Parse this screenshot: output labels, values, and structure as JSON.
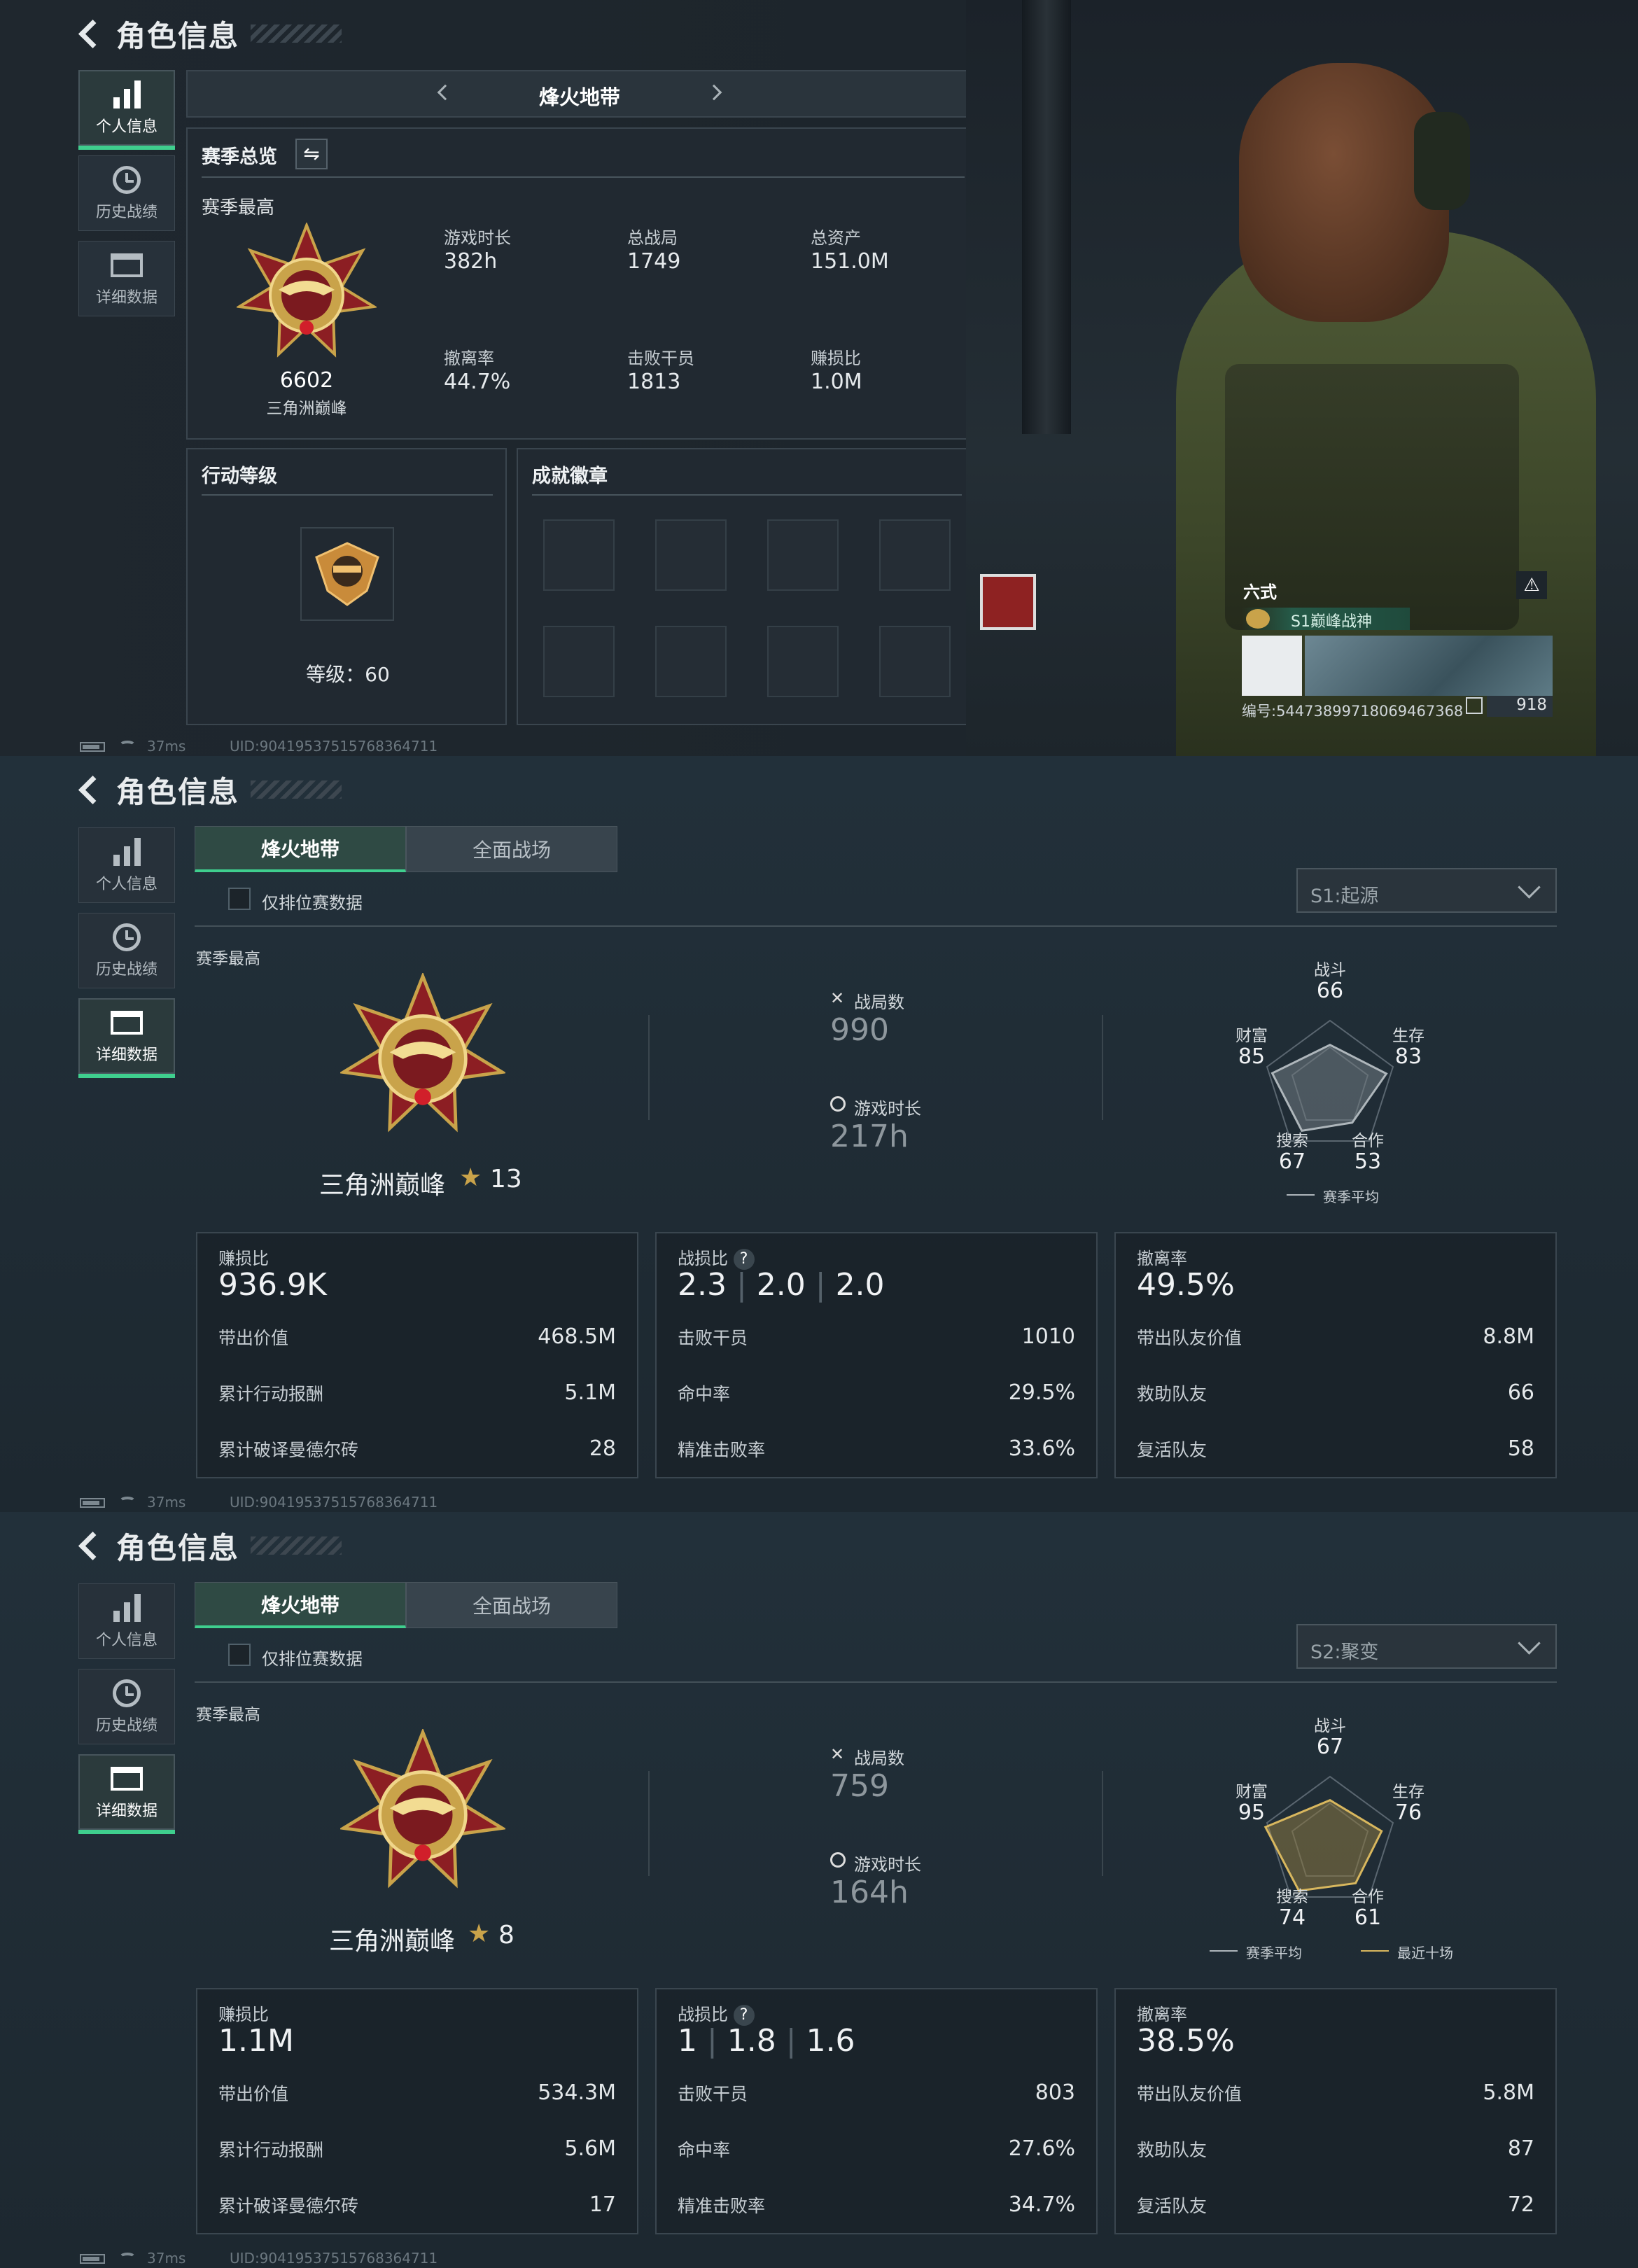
{
  "colors": {
    "accent": "#3fcf8e",
    "gold": "#c9a34a"
  },
  "shared": {
    "title": "角色信息",
    "sidebar": [
      "个人信息",
      "历史战绩",
      "详细数据"
    ],
    "ping": "37ms",
    "uid": "UID:9041953751576836471​1"
  },
  "panel1": {
    "mode_title": "烽火地带",
    "season_overview": "赛季总览",
    "season_best": "赛季最高",
    "rank_score": "6602",
    "rank_name": "三角洲巅峰",
    "stats": [
      {
        "label": "游戏时长",
        "value": "382h"
      },
      {
        "label": "总战局",
        "value": "1749"
      },
      {
        "label": "总资产",
        "value": "151.0M"
      },
      {
        "label": "撤离率",
        "value": "44.7%"
      },
      {
        "label": "击败干员",
        "value": "1813"
      },
      {
        "label": "赚损比",
        "value": "1.0M"
      }
    ],
    "action_level_title": "行动等级",
    "level_text": "等级：60",
    "achievement_title": "成就徽章",
    "player_name": "六式",
    "player_badge": "S1巅峰战神",
    "player_id": "编号:544738997180694673​68",
    "likes": "918"
  },
  "panel2": {
    "tabs": [
      "烽火地带",
      "全面战场"
    ],
    "ranked_only": "仅排位赛数据",
    "season": "S1:起源",
    "season_best": "赛季最高",
    "rank_name": "三角洲巅峰",
    "stars": "13",
    "matches_label": "战局数",
    "matches": "990",
    "time_label": "游戏时长",
    "time": "217h",
    "radar": {
      "labels": [
        "战斗",
        "生存",
        "合作",
        "搜索",
        "财富"
      ],
      "values": [
        "66",
        "83",
        "53",
        "67",
        "85"
      ],
      "values_num": [
        66,
        83,
        53,
        67,
        85
      ],
      "legend": [
        "赛季平均"
      ]
    },
    "cards": [
      {
        "title": "赚损比",
        "big": "936.9K",
        "rows": [
          [
            "带出价值",
            "468.5M"
          ],
          [
            "累计行动报酬",
            "5.1M"
          ],
          [
            "累计破译曼德尔砖",
            "28"
          ]
        ]
      },
      {
        "title": "战损比",
        "big_parts": [
          "2.3",
          "2.0",
          "2.0"
        ],
        "rows": [
          [
            "击败干员",
            "1010"
          ],
          [
            "命中率",
            "29.5%"
          ],
          [
            "精准击败率",
            "33.6%"
          ]
        ]
      },
      {
        "title": "撤离率",
        "big": "49.5%",
        "rows": [
          [
            "带出队友价值",
            "8.8M"
          ],
          [
            "救助队友",
            "66"
          ],
          [
            "复活队友",
            "58"
          ]
        ]
      }
    ]
  },
  "panel3": {
    "tabs": [
      "烽火地带",
      "全面战场"
    ],
    "ranked_only": "仅排位赛数据",
    "season": "S2:聚变",
    "season_best": "赛季最高",
    "rank_name": "三角洲巅峰",
    "stars": "8",
    "matches_label": "战局数",
    "matches": "759",
    "time_label": "游戏时长",
    "time": "164h",
    "radar": {
      "labels": [
        "战斗",
        "生存",
        "合作",
        "搜索",
        "财富"
      ],
      "values": [
        "67",
        "76",
        "61",
        "74",
        "95"
      ],
      "values_num": [
        67,
        76,
        61,
        74,
        95
      ],
      "legend": [
        "赛季平均",
        "最近十场"
      ]
    },
    "cards": [
      {
        "title": "赚损比",
        "big": "1.1M",
        "rows": [
          [
            "带出价值",
            "534.3M"
          ],
          [
            "累计行动报酬",
            "5.6M"
          ],
          [
            "累计破译曼德尔砖",
            "17"
          ]
        ]
      },
      {
        "title": "战损比",
        "big_parts": [
          "1",
          "1.8",
          "1.6"
        ],
        "rows": [
          [
            "击败干员",
            "803"
          ],
          [
            "命中率",
            "27.6%"
          ],
          [
            "精准击败率",
            "34.7%"
          ]
        ]
      },
      {
        "title": "撤离率",
        "big": "38.5%",
        "rows": [
          [
            "带出队友价值",
            "5.8M"
          ],
          [
            "救助队友",
            "87"
          ],
          [
            "复活队友",
            "72"
          ]
        ]
      }
    ]
  }
}
